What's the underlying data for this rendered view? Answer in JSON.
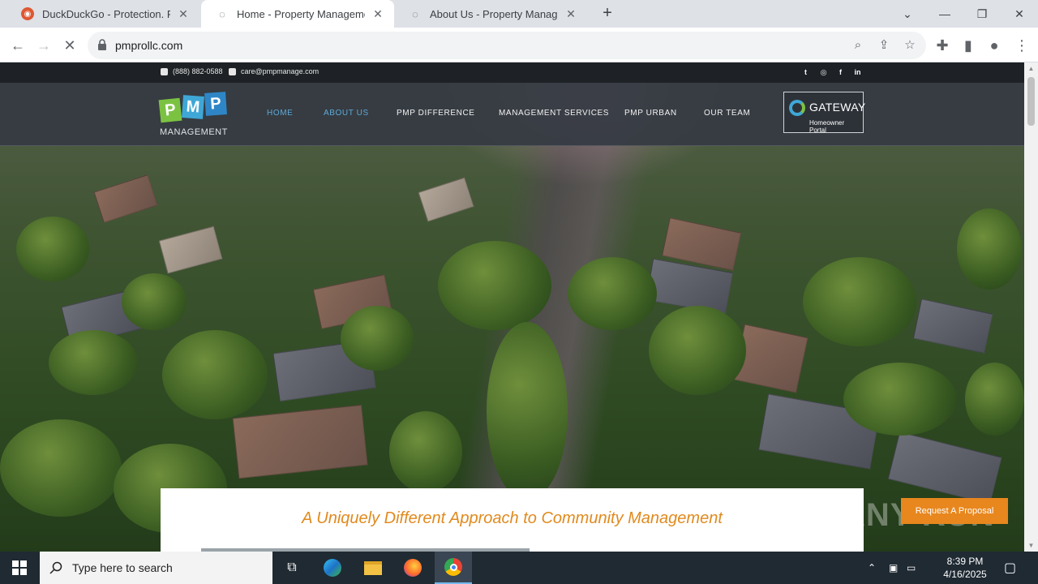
{
  "browser": {
    "tabs": [
      {
        "title": "DuckDuckGo - Protection. Privacy",
        "favicon": "duckduckgo-icon",
        "active": false
      },
      {
        "title": "Home - Property Management I",
        "favicon": "loading-icon",
        "active": true
      },
      {
        "title": "About Us - Property Management",
        "favicon": "loading-icon",
        "active": false
      }
    ],
    "url": "pmprollc.com"
  },
  "site": {
    "phone": "(888) 882-0588",
    "email": "care@pmpmanage.com",
    "logo": {
      "letters": [
        "P",
        "M",
        "P"
      ],
      "subtitle": "MANAGEMENT",
      "colors": [
        "#7cc242",
        "#3fa7d6",
        "#2f86c7"
      ]
    },
    "nav": [
      "HOME",
      "ABOUT US",
      "PMP DIFFERENCE",
      "MANAGEMENT SERVICES",
      "PMP URBAN",
      "OUR TEAM"
    ],
    "gateway": {
      "title": "GATEWAY",
      "subtitle": "Homeowner Portal"
    },
    "tagline": "A Uniquely Different Approach to Community Management",
    "proposal_button": "Request A Proposal",
    "accent": "#e08a1e",
    "nav_highlight": "#5fa9d9"
  },
  "overlay": {
    "watermark": "ANY RUN"
  },
  "taskbar": {
    "search_placeholder": "Type here to search",
    "time": "8:39 PM",
    "date": "4/16/2025"
  }
}
